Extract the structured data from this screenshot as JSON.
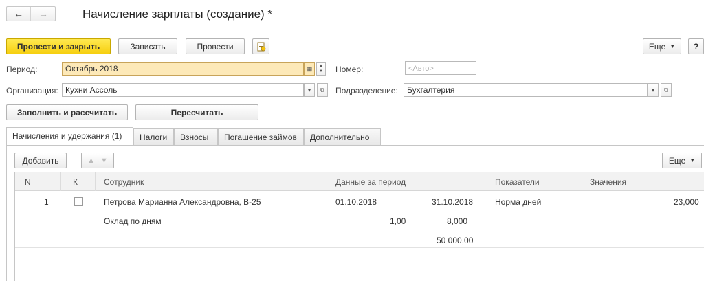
{
  "nav": {
    "back": "←",
    "forward": "→"
  },
  "title": "Начисление зарплаты (создание) *",
  "toolbar": {
    "post_close": "Провести и закрыть",
    "save": "Записать",
    "post": "Провести",
    "more": "Еще",
    "help": "?"
  },
  "form": {
    "period_label": "Период:",
    "period_value": "Октябрь 2018",
    "number_label": "Номер:",
    "number_placeholder": "<Авто>",
    "org_label": "Организация:",
    "org_value": "Кухни Ассоль",
    "dept_label": "Подразделение:",
    "dept_value": "Бухгалтерия"
  },
  "actions": {
    "fill_calc": "Заполнить и рассчитать",
    "recalc": "Пересчитать"
  },
  "tabs": [
    {
      "label": "Начисления и удержания (1)",
      "active": true
    },
    {
      "label": "Налоги"
    },
    {
      "label": "Взносы"
    },
    {
      "label": "Погашение займов"
    },
    {
      "label": "Дополнительно"
    }
  ],
  "table_toolbar": {
    "add": "Добавить",
    "more": "Еще"
  },
  "table": {
    "columns": {
      "n": "N",
      "k": "К",
      "employee": "Сотрудник",
      "period": "Данные за период",
      "indicators": "Показатели",
      "values": "Значения"
    },
    "rows": [
      {
        "n": "1",
        "employee": "Петрова Марианна Александровна, В-25",
        "accrual": "Оклад по дням",
        "date_from": "01.10.2018",
        "date_to": "31.10.2018",
        "qty": "1,00",
        "days": "8,000",
        "amount": "50 000,00",
        "indicator": "Норма дней",
        "indicator_value": "23,000"
      }
    ]
  },
  "colors": {
    "accent": "#f6cf10",
    "period_field": "#fde9b8"
  }
}
